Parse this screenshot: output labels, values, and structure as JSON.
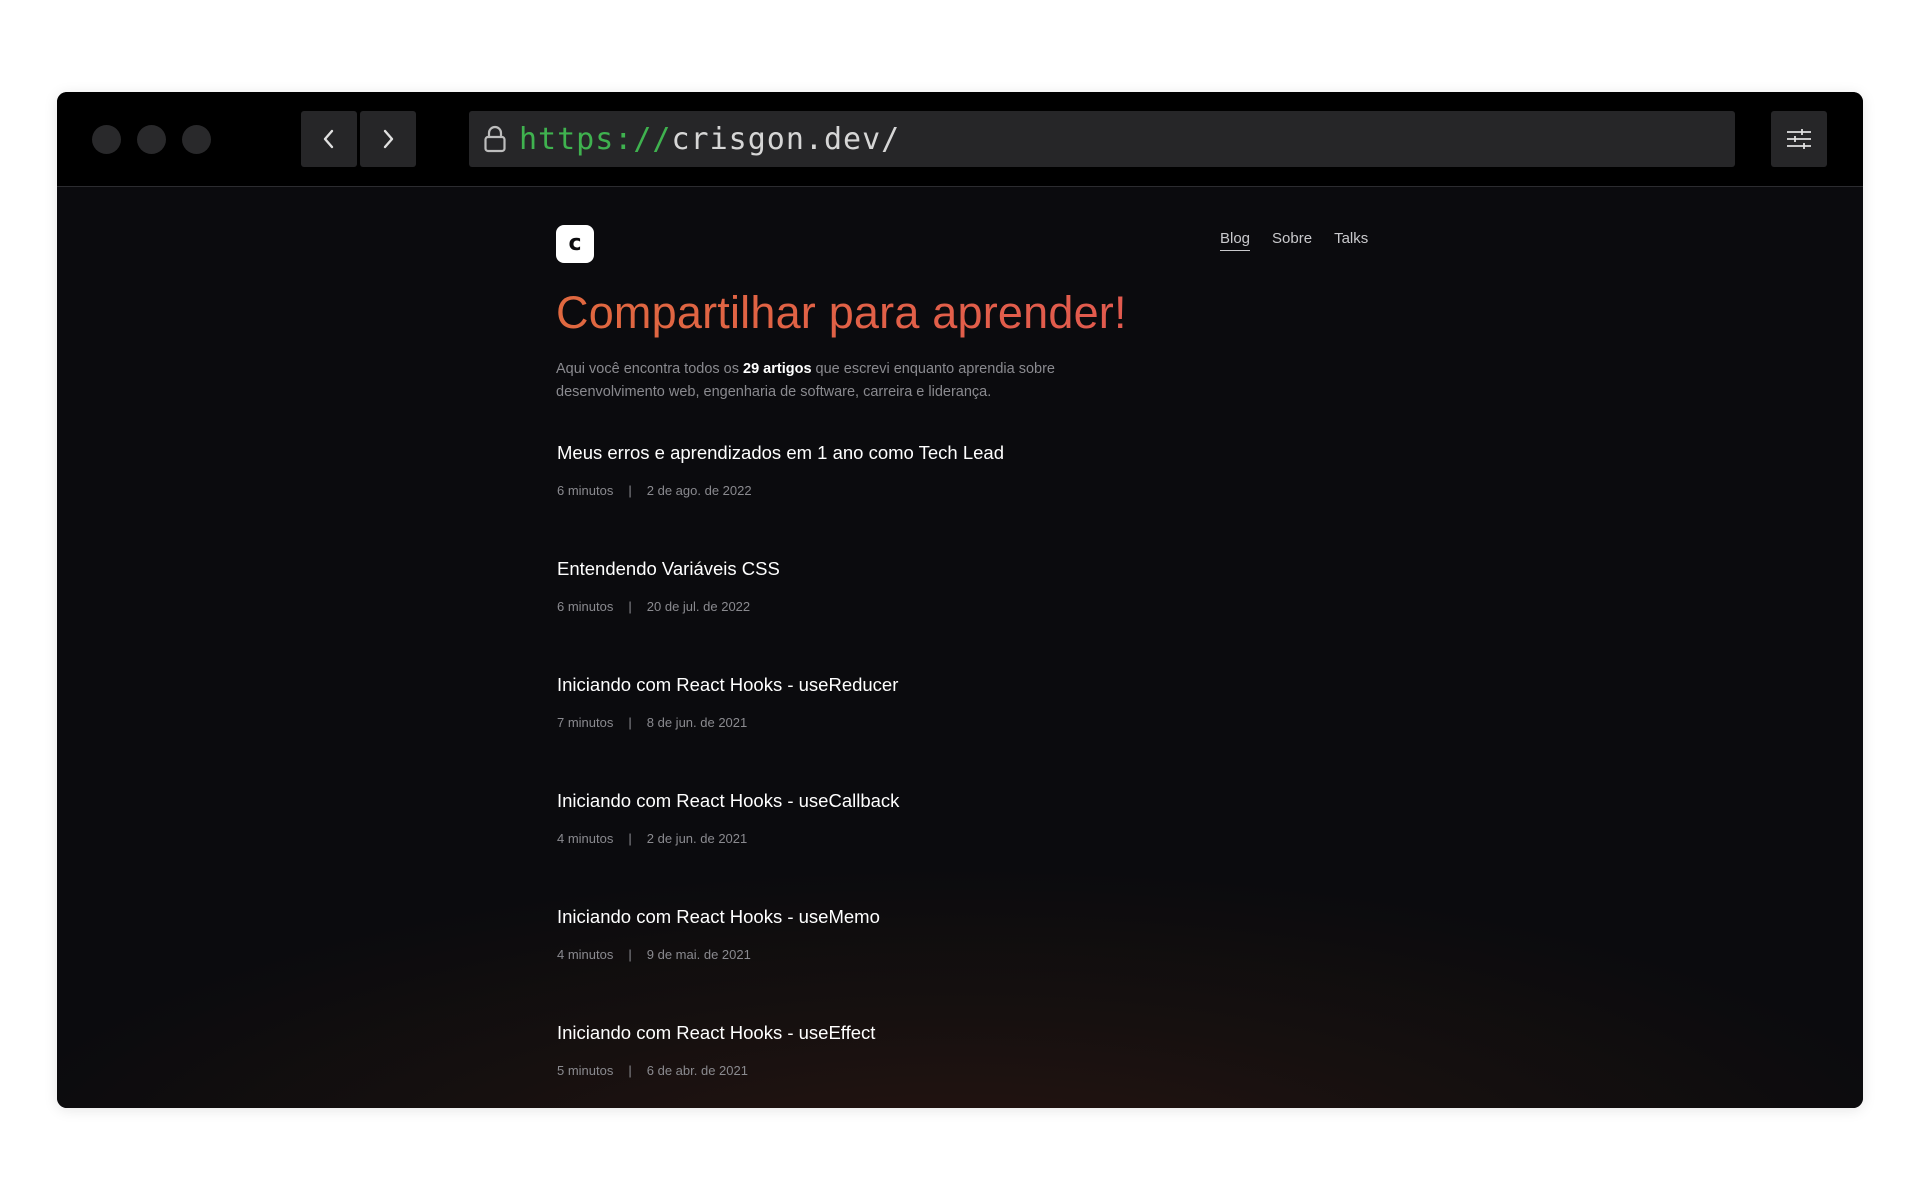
{
  "browser": {
    "url_scheme": "https://",
    "url_host": "crisgon.dev/",
    "back_icon": "chevron-left-icon",
    "forward_icon": "chevron-right-icon",
    "lock_icon": "lock-icon",
    "settings_icon": "sliders-icon"
  },
  "site": {
    "logo_letter": "c",
    "nav": {
      "blog": "Blog",
      "sobre": "Sobre",
      "talks": "Talks"
    },
    "hero_title": "Compartilhar para aprender!",
    "intro": {
      "before": "Aqui você encontra todos os ",
      "highlight": "29 artigos",
      "after": " que escrevi enquanto aprendia sobre desenvolvimento web, engenharia de software, carreira e liderança."
    },
    "articles": [
      {
        "title": "Meus erros e aprendizados em 1 ano como Tech Lead",
        "read_time": "6 minutos",
        "date": "2 de ago. de 2022"
      },
      {
        "title": "Entendendo Variáveis CSS",
        "read_time": "6 minutos",
        "date": "20 de jul. de 2022"
      },
      {
        "title": "Iniciando com React Hooks - useReducer",
        "read_time": "7 minutos",
        "date": "8 de jun. de 2021"
      },
      {
        "title": "Iniciando com React Hooks - useCallback",
        "read_time": "4 minutos",
        "date": "2 de jun. de 2021"
      },
      {
        "title": "Iniciando com React Hooks - useMemo",
        "read_time": "4 minutos",
        "date": "9 de mai. de 2021"
      },
      {
        "title": "Iniciando com React Hooks - useEffect",
        "read_time": "5 minutos",
        "date": "6 de abr. de 2021"
      }
    ],
    "meta_separator": "|"
  },
  "colors": {
    "accent_start": "#e0683f",
    "accent_end": "#e25a4e",
    "url_scheme": "#3fb24f",
    "background": "#0b0b0e"
  }
}
